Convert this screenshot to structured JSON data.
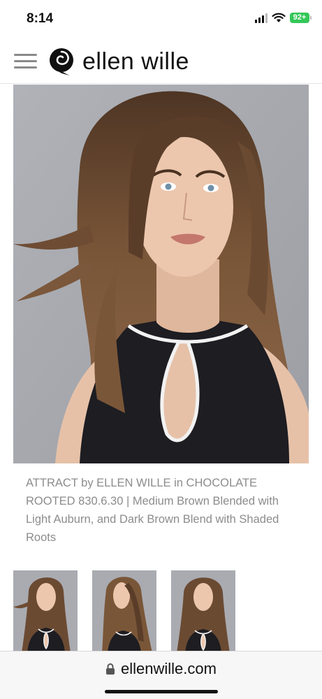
{
  "status": {
    "time": "8:14",
    "battery": "92+"
  },
  "header": {
    "brand": "ellen wille",
    "icons": [
      "menu-icon",
      "logo-mark"
    ]
  },
  "product": {
    "caption": "ATTRACT by ELLEN WILLE in CHOCOLATE ROOTED 830.6.30 | Medium Brown Blended with Light Auburn, and Dark Brown Blend with Shaded Roots",
    "thumbnails": [
      "front view",
      "side view",
      "front view alt"
    ]
  },
  "browser": {
    "url": "ellenwille.com",
    "icons": [
      "lock-icon"
    ]
  },
  "colors": {
    "background": "#ffffff",
    "caption": "#8c8c8c",
    "photo_backdrop": "#a5a7ad",
    "hair": "#6b4a32",
    "battery": "#34c759"
  }
}
